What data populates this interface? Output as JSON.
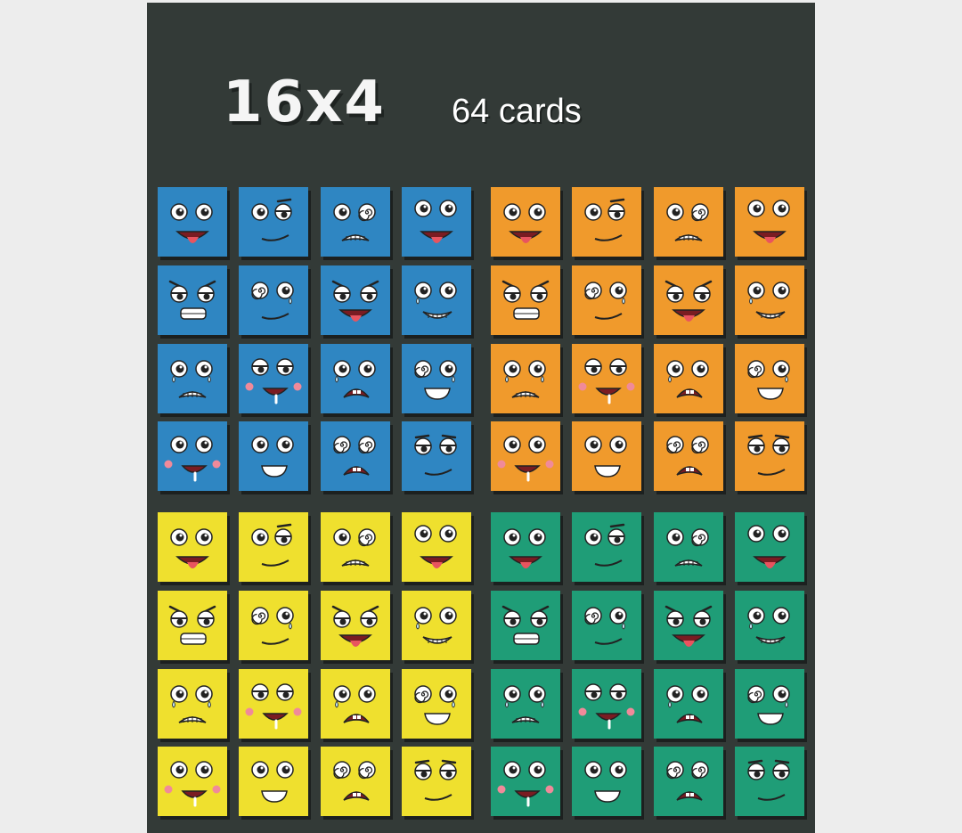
{
  "header": {
    "grid_label": "16x4",
    "count_label": "64 cards"
  },
  "colors": {
    "blue": "#2f86c2",
    "orange": "#f09a2c",
    "yellow": "#efe02e",
    "green": "#1f9d77",
    "board": "#333a37",
    "page": "#ededed"
  },
  "card_sets": [
    {
      "name": "blue-set",
      "color": "blue"
    },
    {
      "name": "orange-set",
      "color": "orange"
    },
    {
      "name": "yellow-set",
      "color": "yellow"
    },
    {
      "name": "green-set",
      "color": "green"
    }
  ],
  "expressions": [
    [
      "tongue",
      "smirk",
      "grimace",
      "tongue-worried"
    ],
    [
      "angry-teeth",
      "dizzy-tear",
      "angry-tongue",
      "tear-grin"
    ],
    [
      "tear-grimace",
      "drool-blush",
      "sad-open",
      "dizzy-grin"
    ],
    [
      "blush-drool",
      "grin",
      "dizzy-open",
      "tired-smile"
    ]
  ]
}
